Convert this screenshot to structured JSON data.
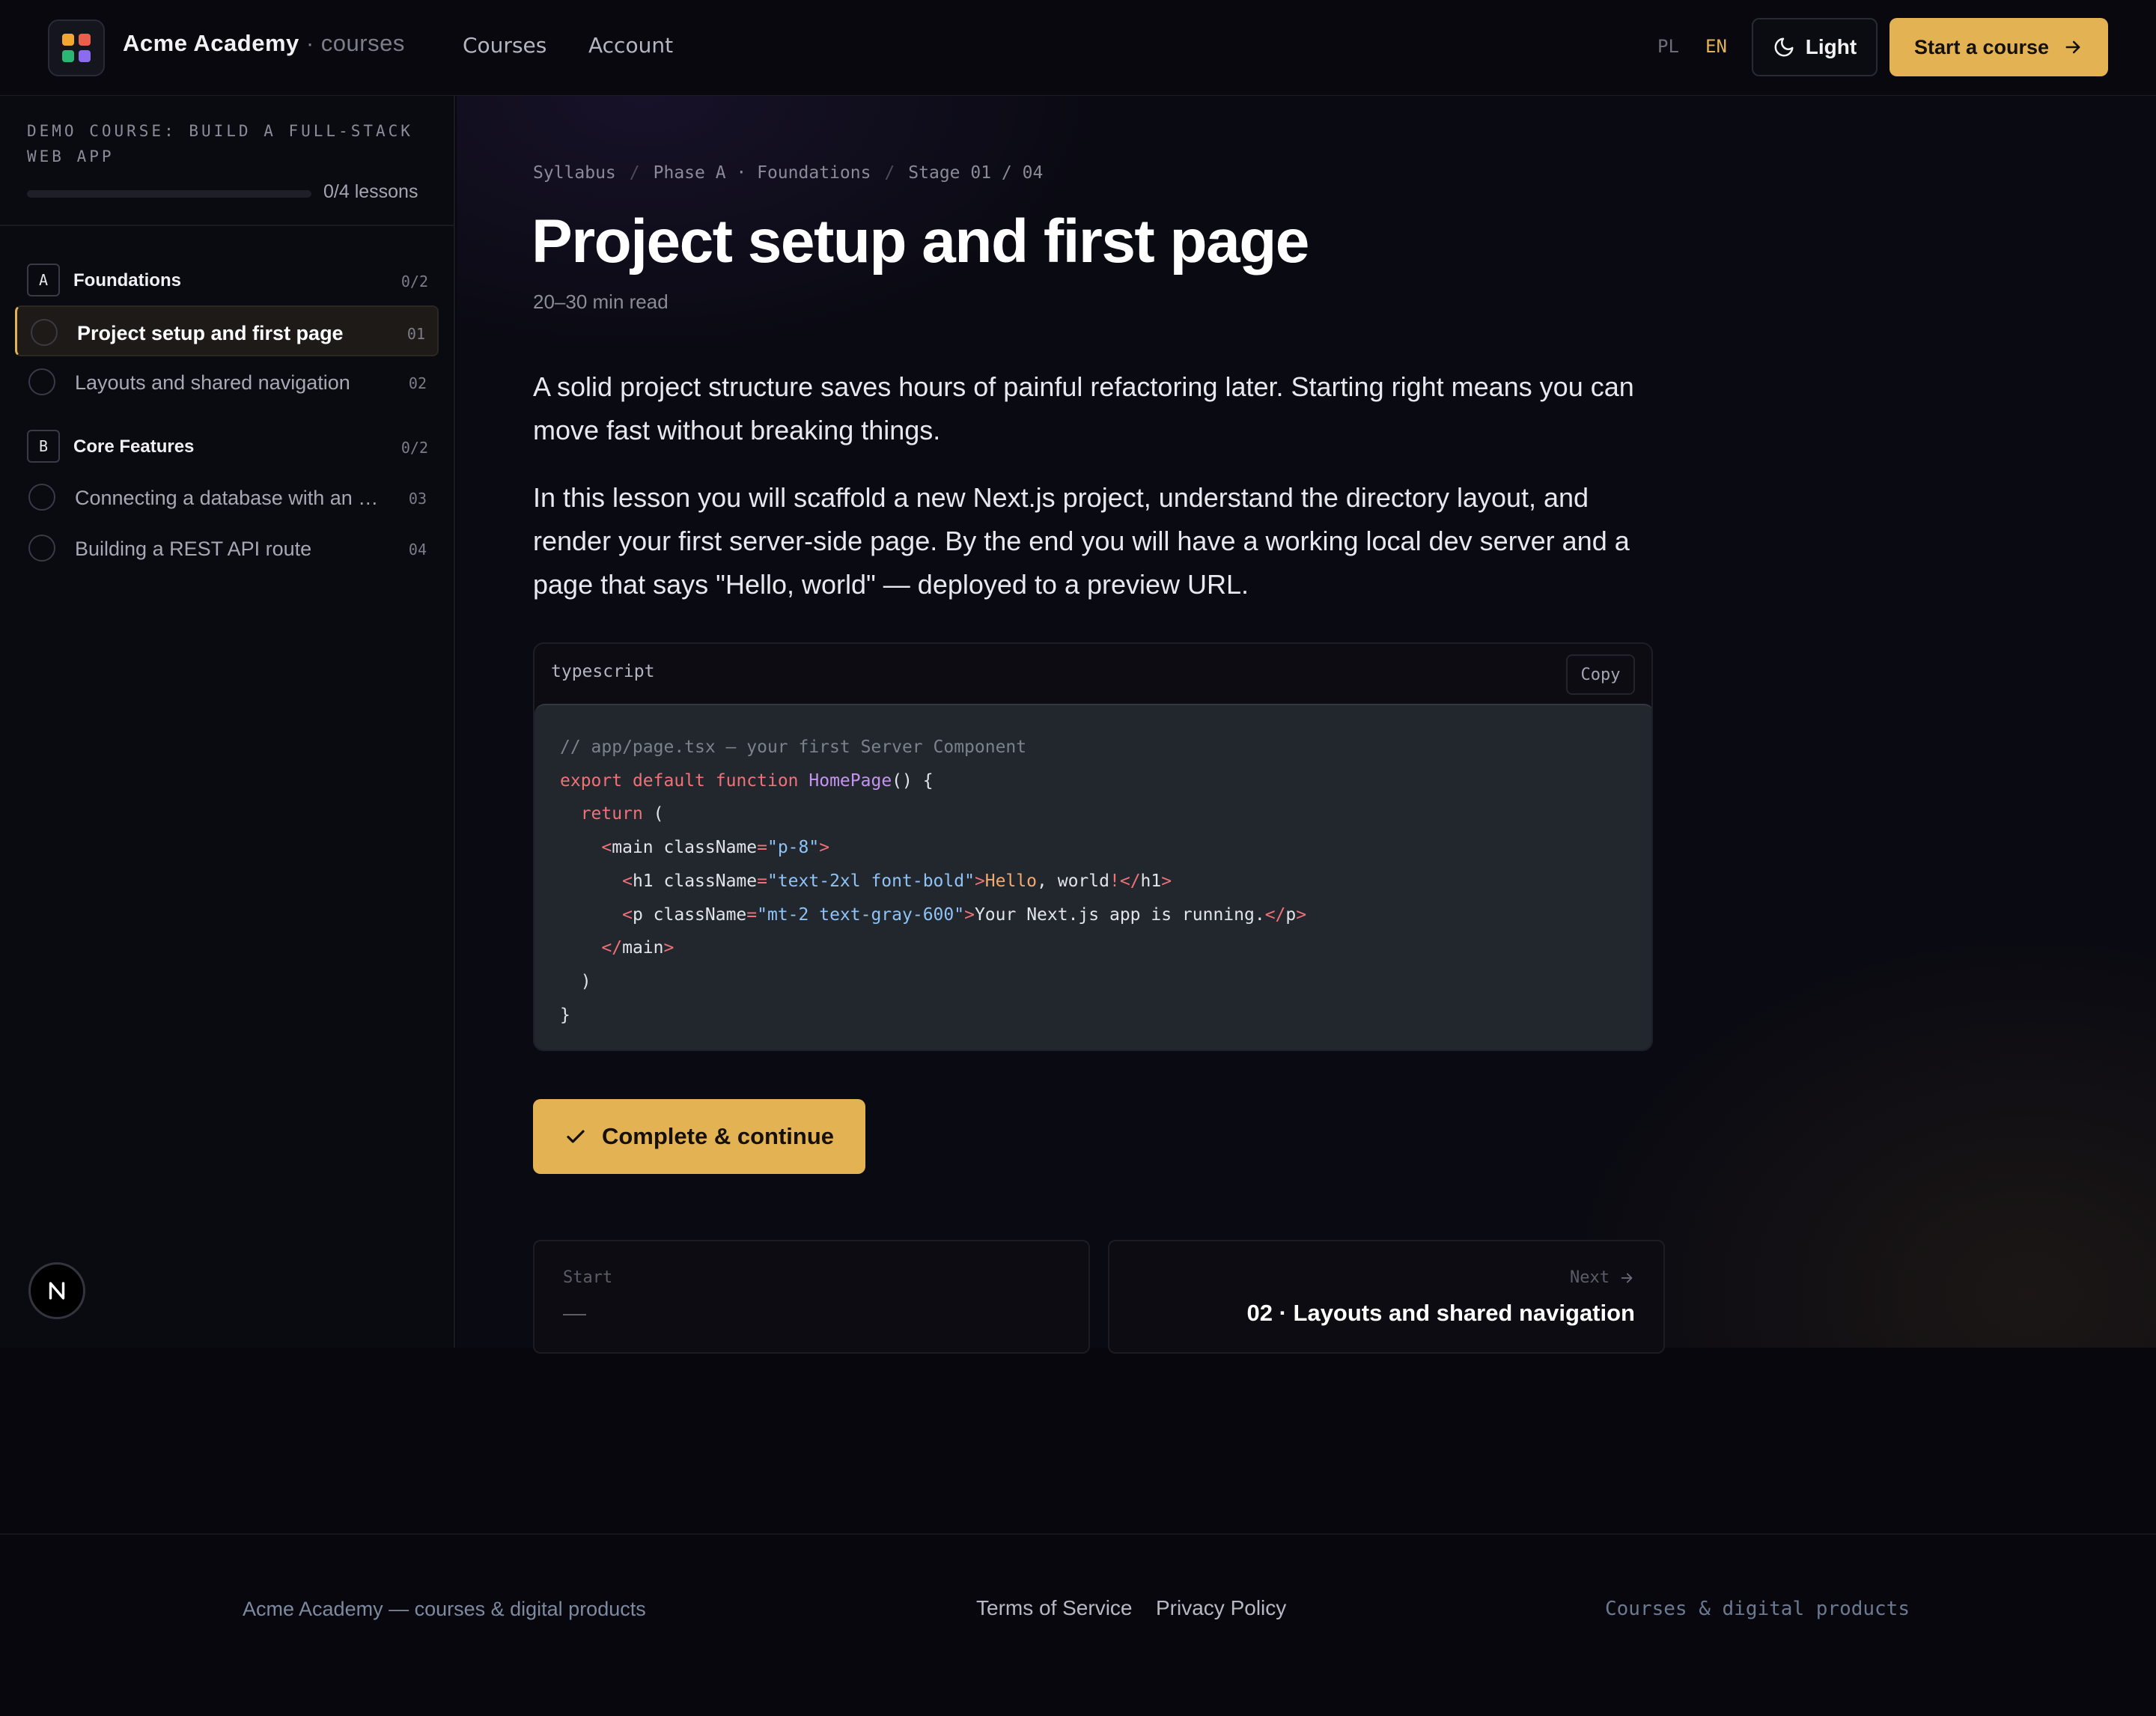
{
  "header": {
    "brand": "Acme Academy",
    "brand_suffix": " · courses",
    "nav": [
      "Courses",
      "Account"
    ],
    "languages": [
      "PL",
      "EN"
    ],
    "active_language": "EN",
    "theme_toggle_label": "Light",
    "cta_label": "Start a course",
    "logo_colors": [
      "#f0a830",
      "#e8604c",
      "#2bb673",
      "#8b6cf0"
    ]
  },
  "sidebar": {
    "course_title": "Demo course: build a full-stack web app",
    "progress_label": "0/4 lessons",
    "progress_fraction": 0,
    "sections": [
      {
        "badge": "A",
        "name": "Foundations",
        "count": "0/2",
        "lessons": [
          {
            "title": "Project setup and first page",
            "num": "01",
            "active": true
          },
          {
            "title": "Layouts and shared navigation",
            "num": "02",
            "active": false
          }
        ]
      },
      {
        "badge": "B",
        "name": "Core Features",
        "count": "0/2",
        "lessons": [
          {
            "title": "Connecting a database with an ORM",
            "num": "03",
            "active": false
          },
          {
            "title": "Building a REST API route",
            "num": "04",
            "active": false
          }
        ]
      }
    ]
  },
  "main": {
    "breadcrumb": [
      "Syllabus",
      "Phase A · Foundations",
      "Stage 01 / 04"
    ],
    "title": "Project setup and first page",
    "read_time": "20–30 min read",
    "paragraphs": [
      "A solid project structure saves hours of painful refactoring later. Starting right means you can move fast without breaking things.",
      "In this lesson you will scaffold a new Next.js project, understand the directory layout, and render your first server-side page. By the end you will have a working local dev server and a page that says \"Hello, world\" — deployed to a preview URL."
    ],
    "code": {
      "language": "typescript",
      "copy_label": "Copy",
      "lines": [
        "// app/page.tsx — your first Server Component",
        "export default function HomePage() {",
        "  return (",
        "    <main className=\"p-8\">",
        "      <h1 className=\"text-2xl font-bold\">Hello, world!</h1>",
        "      <p className=\"mt-2 text-gray-600\">Your Next.js app is running.</p>",
        "    </main>",
        "  )",
        "}"
      ]
    },
    "complete_label": "Complete & continue",
    "prev": {
      "kicker": "Start",
      "value": "—"
    },
    "next": {
      "kicker": "Next",
      "value": "02 · Layouts and shared navigation"
    }
  },
  "footer": {
    "left": "Acme Academy — courses & digital products",
    "links": [
      "Terms of Service",
      "Privacy Policy"
    ],
    "right": "Courses & digital products"
  },
  "colors": {
    "accent": "#e3b253",
    "background": "#07070d"
  }
}
